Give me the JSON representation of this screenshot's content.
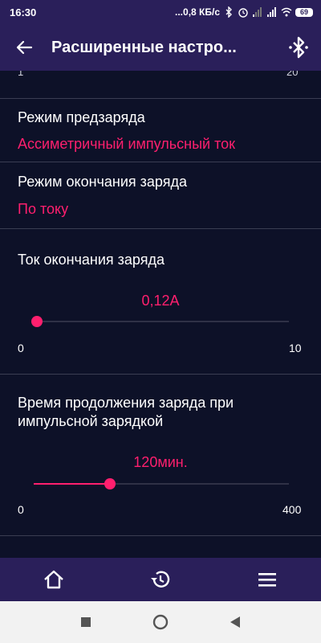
{
  "status_bar": {
    "time": "16:30",
    "network_speed": "...0,8 КБ/с",
    "battery": "69"
  },
  "app_bar": {
    "title": "Расширенные настро..."
  },
  "cut_slider": {
    "min_label": "1",
    "max_label": "20"
  },
  "precharge": {
    "title": "Режим предзаряда",
    "value": "Ассиметричный импульсный ток"
  },
  "charge_end_mode": {
    "title": "Режим окончания заряда",
    "value": "По току"
  },
  "end_current": {
    "title": "Ток окончания заряда",
    "value": "0,12А",
    "level": 0.012,
    "min_label": "0",
    "max_label": "10"
  },
  "charge_duration": {
    "title_line1": "Время продолжения заряда при",
    "title_line2": "импульсной зарядкой",
    "value": "120мин.",
    "level": 0.3,
    "min_label": "0",
    "max_label": "400"
  },
  "bottom_nav": {
    "items": [
      "home-icon",
      "history-icon",
      "menu-icon"
    ]
  },
  "colors": {
    "accent": "#ff1f6e",
    "bar": "#2a1f5a",
    "background": "#0d1128"
  }
}
